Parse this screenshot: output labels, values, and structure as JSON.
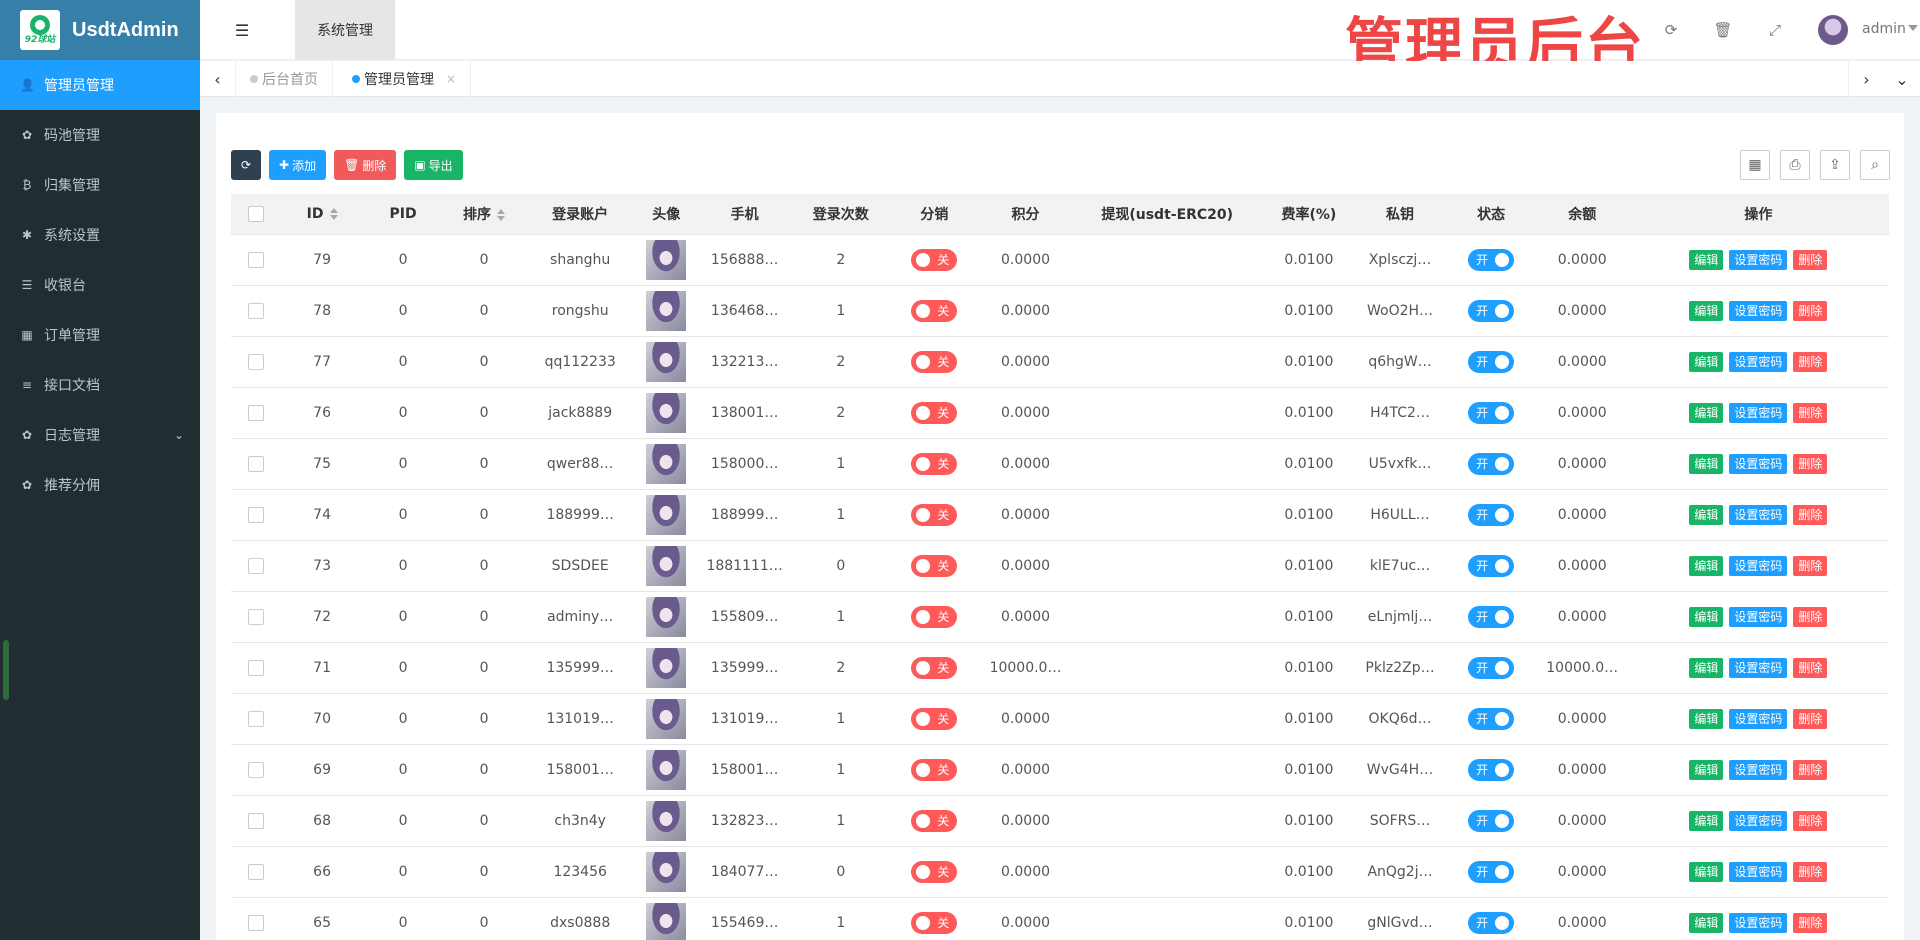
{
  "brand": {
    "name": "UsdtAdmin",
    "logo_text": "92球站"
  },
  "sidebar": {
    "items": [
      {
        "label": "管理员管理",
        "icon": "user-icon",
        "active": true
      },
      {
        "label": "码池管理",
        "icon": "android-icon"
      },
      {
        "label": "归集管理",
        "icon": "bitcoin-icon"
      },
      {
        "label": "系统设置",
        "icon": "asterisk-icon"
      },
      {
        "label": "收银台",
        "icon": "list-icon"
      },
      {
        "label": "订单管理",
        "icon": "calculator-icon"
      },
      {
        "label": "接口文档",
        "icon": "align-left-icon"
      },
      {
        "label": "日志管理",
        "icon": "android-icon",
        "has_children": true
      },
      {
        "label": "推荐分佣",
        "icon": "android-icon"
      }
    ]
  },
  "header": {
    "system_tab": "系统管理",
    "banner": "管理员后台",
    "user": "admin"
  },
  "tabs": [
    {
      "label": "后台首页",
      "dot_color": "#cccccc"
    },
    {
      "label": "管理员管理",
      "dot_color": "#1e9fff",
      "closable": true,
      "close_glyph": "×"
    }
  ],
  "toolbar": {
    "refresh": "",
    "add": "添加",
    "delete": "删除",
    "export": "导出"
  },
  "table": {
    "columns": [
      "ID",
      "PID",
      "排序",
      "登录账户",
      "头像",
      "手机",
      "登录次数",
      "分销",
      "积分",
      "提现(usdt-ERC20)",
      "费率(%)",
      "私钥",
      "状态",
      "余额",
      "操作"
    ],
    "distribution_label": "关",
    "status_label": "开",
    "actions": {
      "edit": "编辑",
      "set_password": "设置密码",
      "delete": "删除"
    },
    "rows": [
      {
        "id": "79",
        "pid": "0",
        "sort": "0",
        "account": "shanghu",
        "phone": "156888…",
        "logins": "2",
        "points": "0.0000",
        "withdraw": "",
        "rate": "0.0100",
        "key": "Xplsczj…",
        "balance": "0.0000"
      },
      {
        "id": "78",
        "pid": "0",
        "sort": "0",
        "account": "rongshu",
        "phone": "136468…",
        "logins": "1",
        "points": "0.0000",
        "withdraw": "",
        "rate": "0.0100",
        "key": "WoO2H…",
        "balance": "0.0000"
      },
      {
        "id": "77",
        "pid": "0",
        "sort": "0",
        "account": "qq112233",
        "phone": "132213…",
        "logins": "2",
        "points": "0.0000",
        "withdraw": "",
        "rate": "0.0100",
        "key": "q6hgW…",
        "balance": "0.0000"
      },
      {
        "id": "76",
        "pid": "0",
        "sort": "0",
        "account": "jack8889",
        "phone": "138001…",
        "logins": "2",
        "points": "0.0000",
        "withdraw": "",
        "rate": "0.0100",
        "key": "H4TC2…",
        "balance": "0.0000"
      },
      {
        "id": "75",
        "pid": "0",
        "sort": "0",
        "account": "qwer88…",
        "phone": "158000…",
        "logins": "1",
        "points": "0.0000",
        "withdraw": "",
        "rate": "0.0100",
        "key": "U5vxfk…",
        "balance": "0.0000"
      },
      {
        "id": "74",
        "pid": "0",
        "sort": "0",
        "account": "188999…",
        "phone": "188999…",
        "logins": "1",
        "points": "0.0000",
        "withdraw": "",
        "rate": "0.0100",
        "key": "H6ULL…",
        "balance": "0.0000"
      },
      {
        "id": "73",
        "pid": "0",
        "sort": "0",
        "account": "SDSDEE",
        "phone": "1881111…",
        "logins": "0",
        "points": "0.0000",
        "withdraw": "",
        "rate": "0.0100",
        "key": "klE7uc…",
        "balance": "0.0000"
      },
      {
        "id": "72",
        "pid": "0",
        "sort": "0",
        "account": "adminy…",
        "phone": "155809…",
        "logins": "1",
        "points": "0.0000",
        "withdraw": "",
        "rate": "0.0100",
        "key": "eLnjmlj…",
        "balance": "0.0000"
      },
      {
        "id": "71",
        "pid": "0",
        "sort": "0",
        "account": "135999…",
        "phone": "135999…",
        "logins": "2",
        "points": "10000.0…",
        "withdraw": "",
        "rate": "0.0100",
        "key": "Pklz2Zp…",
        "balance": "10000.0…"
      },
      {
        "id": "70",
        "pid": "0",
        "sort": "0",
        "account": "131019…",
        "phone": "131019…",
        "logins": "1",
        "points": "0.0000",
        "withdraw": "",
        "rate": "0.0100",
        "key": "OKQ6d…",
        "balance": "0.0000"
      },
      {
        "id": "69",
        "pid": "0",
        "sort": "0",
        "account": "158001…",
        "phone": "158001…",
        "logins": "1",
        "points": "0.0000",
        "withdraw": "",
        "rate": "0.0100",
        "key": "WvG4H…",
        "balance": "0.0000"
      },
      {
        "id": "68",
        "pid": "0",
        "sort": "0",
        "account": "ch3n4y",
        "phone": "132823…",
        "logins": "1",
        "points": "0.0000",
        "withdraw": "",
        "rate": "0.0100",
        "key": "SOFRS…",
        "balance": "0.0000"
      },
      {
        "id": "66",
        "pid": "0",
        "sort": "0",
        "account": "123456",
        "phone": "184077…",
        "logins": "0",
        "points": "0.0000",
        "withdraw": "",
        "rate": "0.0100",
        "key": "AnQg2j…",
        "balance": "0.0000"
      },
      {
        "id": "65",
        "pid": "0",
        "sort": "0",
        "account": "dxs0888",
        "phone": "155469…",
        "logins": "1",
        "points": "0.0000",
        "withdraw": "",
        "rate": "0.0100",
        "key": "gNlGvd…",
        "balance": "0.0000"
      }
    ]
  },
  "colors": {
    "sidebar_bg": "#222d32",
    "logo_bg": "#367fa9",
    "active_blue": "#1e9fff",
    "green": "#18b566",
    "red": "#ff5a5a",
    "banner_red": "#ee4545"
  }
}
